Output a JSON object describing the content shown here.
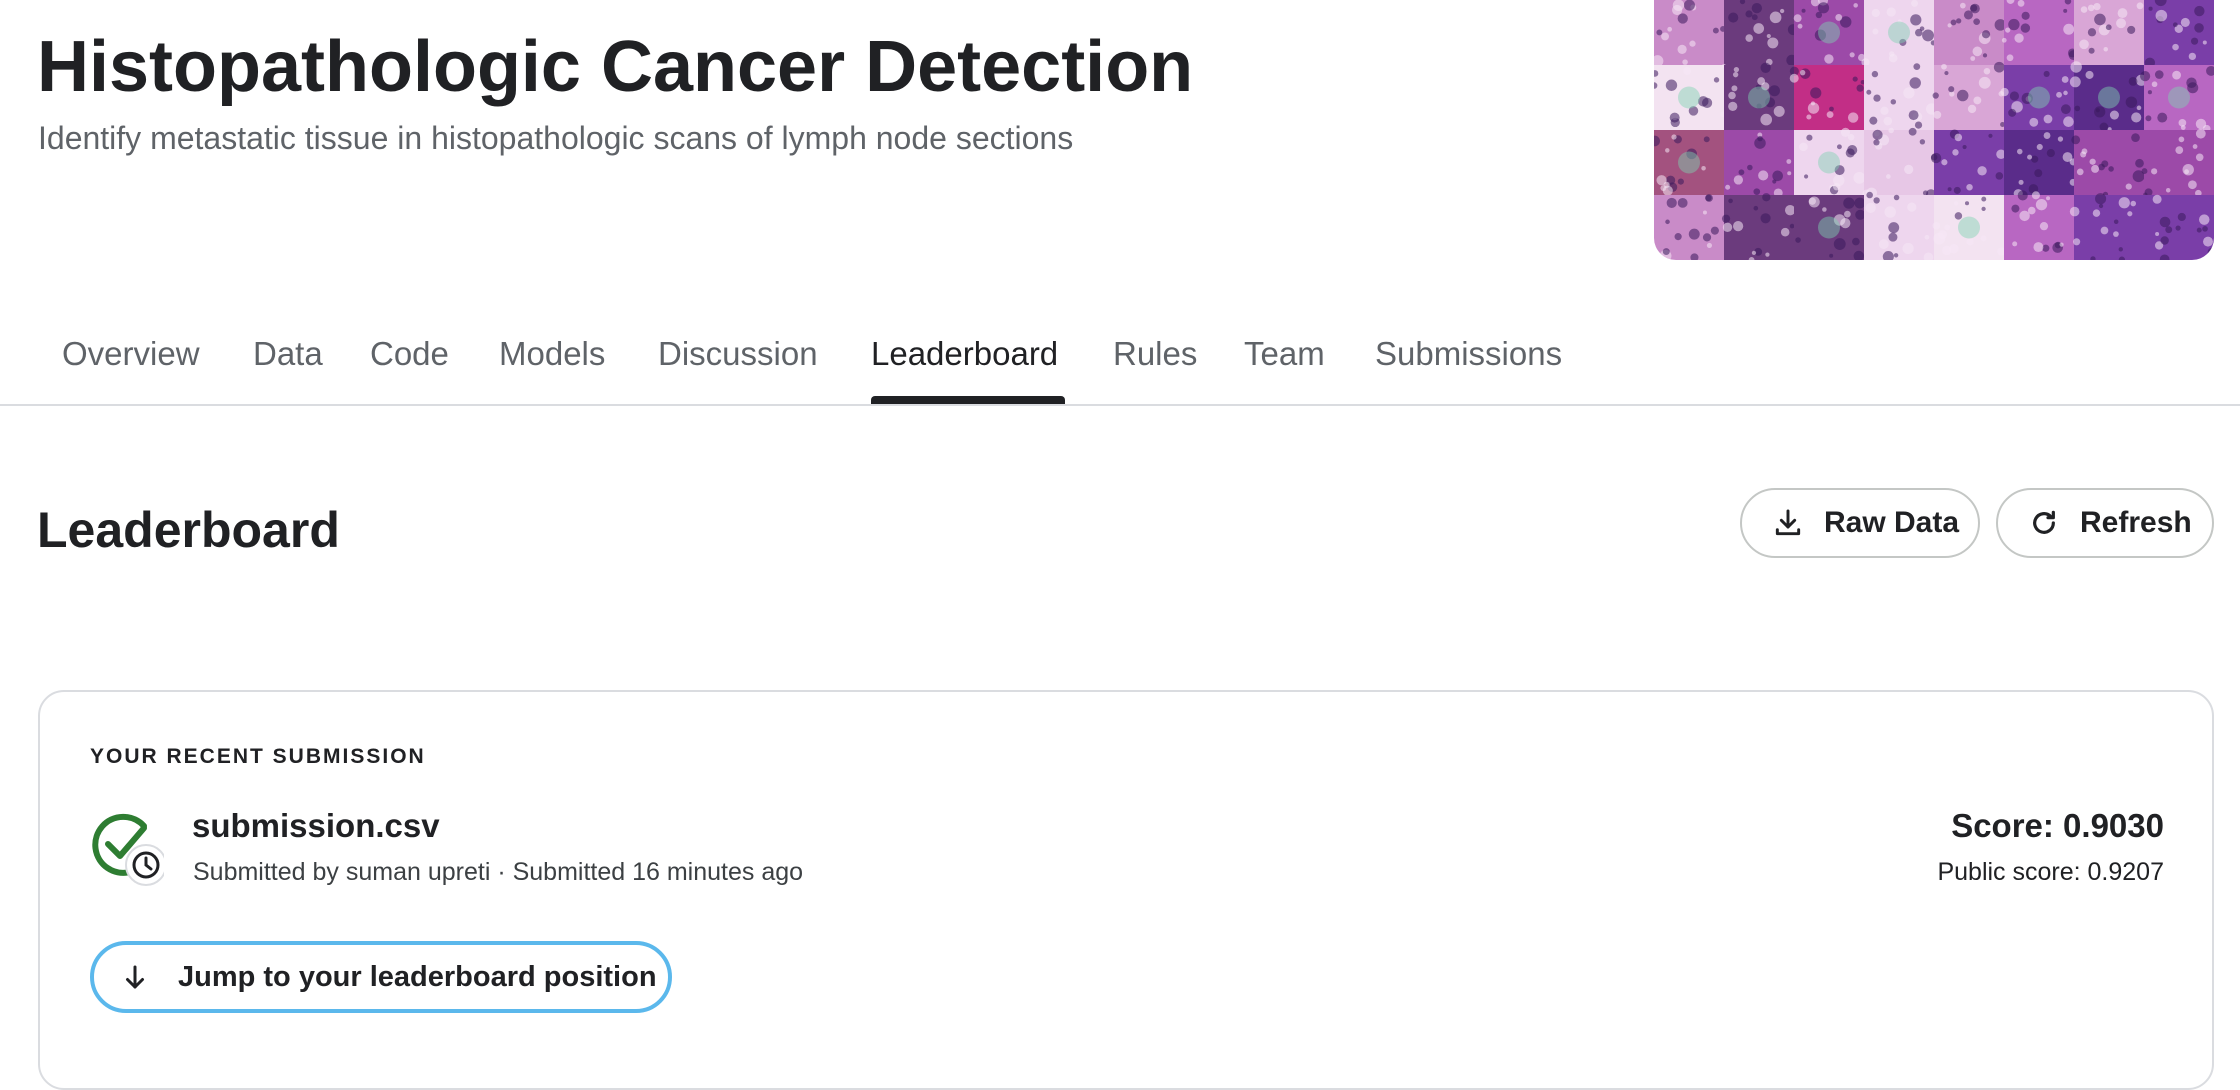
{
  "header": {
    "title": "Histopathologic Cancer Detection",
    "subtitle": "Identify metastatic tissue in histopathologic scans of lymph node sections",
    "banner_image": "histopathology-tile-mosaic"
  },
  "tabs": [
    {
      "label": "Overview"
    },
    {
      "label": "Data"
    },
    {
      "label": "Code"
    },
    {
      "label": "Models"
    },
    {
      "label": "Discussion"
    },
    {
      "label": "Leaderboard",
      "active": true
    },
    {
      "label": "Rules"
    },
    {
      "label": "Team"
    },
    {
      "label": "Submissions"
    }
  ],
  "leaderboard": {
    "title": "Leaderboard",
    "raw_data_label": "Raw Data",
    "raw_data_icon": "download-icon",
    "refresh_label": "Refresh",
    "refresh_icon": "refresh-icon"
  },
  "recent_submission": {
    "section_label": "YOUR RECENT SUBMISSION",
    "status_icon": "check-circle-with-clock-icon",
    "file_name": "submission.csv",
    "meta": "Submitted by suman upreti · Submitted 16 minutes ago",
    "score": "Score: 0.9030",
    "public_score": "Public score: 0.9207",
    "jump_label": "Jump to your leaderboard position",
    "jump_icon": "arrow-down-icon"
  },
  "colors": {
    "text_primary": "#202124",
    "text_secondary": "#5f6368",
    "success_green": "#2e7d32",
    "focus_blue": "#5bb8ec",
    "border": "#dadce0"
  }
}
